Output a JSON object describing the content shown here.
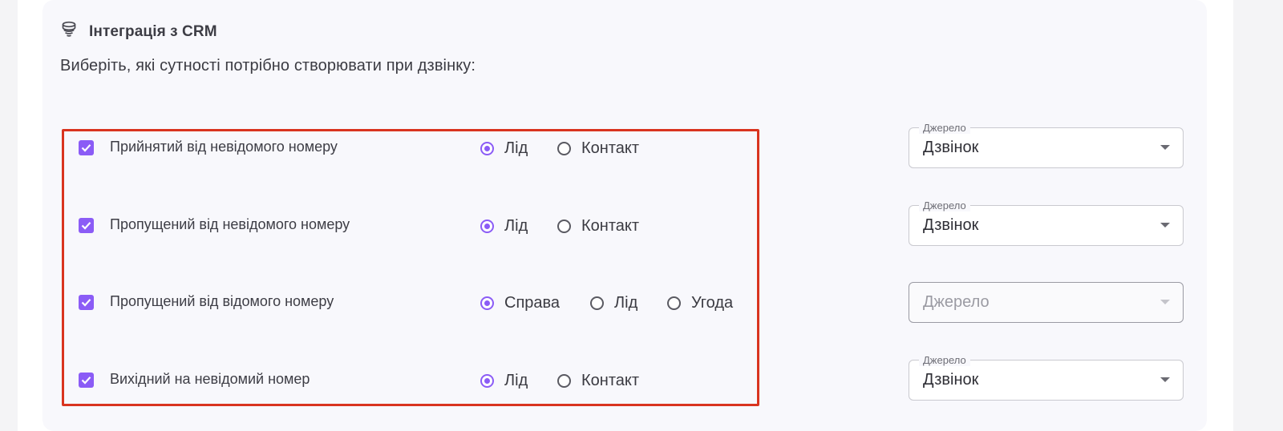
{
  "section": {
    "title": "Інтеграція з CRM",
    "icon": "database-icon",
    "subtitle": "Виберіть, які сутності потрібно створювати при дзвінку:"
  },
  "accent_color": "#8b5cf6",
  "highlight_color": "#d9341f",
  "rows": [
    {
      "label": "Прийнятий від невідомого номеру",
      "checked": true,
      "options": [
        "Лід",
        "Контакт"
      ],
      "selected": "Лід",
      "source": {
        "legend": "Джерело",
        "value": "Дзвінок"
      }
    },
    {
      "label": "Пропущений від невідомого номеру",
      "checked": true,
      "options": [
        "Лід",
        "Контакт"
      ],
      "selected": "Лід",
      "source": {
        "legend": "Джерело",
        "value": "Дзвінок"
      }
    },
    {
      "label": "Пропущений від відомого номеру",
      "checked": true,
      "options": [
        "Справа",
        "Лід",
        "Угода"
      ],
      "selected": "Справа",
      "source": {
        "placeholder": "Джерело",
        "value": ""
      }
    },
    {
      "label": "Вихідний на невідомий номер",
      "checked": true,
      "options": [
        "Лід",
        "Контакт"
      ],
      "selected": "Лід",
      "source": {
        "legend": "Джерело",
        "value": "Дзвінок"
      }
    }
  ]
}
